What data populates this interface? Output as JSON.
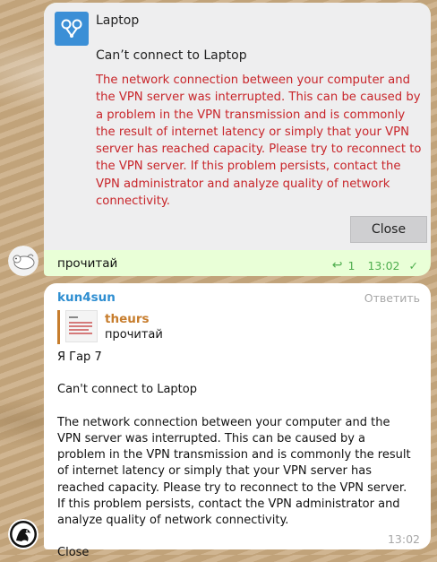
{
  "photo_message": {
    "dialog": {
      "title": "Laptop",
      "heading": "Can’t connect to Laptop",
      "body": "The network connection between your computer and the VPN server was interrupted.  This can be caused by a problem in the VPN transmission and is commonly the result of internet latency or simply that your VPN server has reached capacity.  Please try to reconnect to the VPN server.  If this problem persists, contact the VPN administrator and analyze quality of network connectivity.",
      "close_label": "Close"
    },
    "caption": "прочитай",
    "reply_count": "1",
    "time": "13:02",
    "read_mark": "✓"
  },
  "reply_message": {
    "sender": "kun4sun",
    "reply_action": "Ответить",
    "quote": {
      "author": "theurs",
      "text": "прочитай"
    },
    "lines": {
      "l1": "Я Гар 7",
      "l2": "Can't connect to Laptop",
      "l3": "The network connection between your computer and the VPN server was interrupted. This can be caused by a problem in the VPN transmission and is commonly the result of internet latency or simply that your VPN server has reached capacity. Please try to reconnect to the VPN server. If this problem persists, contact the VPN administrator and analyze quality of network connectivity.",
      "l4": "Close"
    },
    "time": "13:02"
  },
  "colors": {
    "outgoing_bubble": "#e9ffd7",
    "incoming_bubble": "#ffffff",
    "error_text": "#c8252a",
    "sender_name": "#2e8ed1",
    "quote_accent": "#c77d2d",
    "read_green": "#4fae4e"
  },
  "icons": {
    "app_logo": "vpn-logo-icon",
    "reply": "reply-arrow-icon",
    "read": "double-check-icon"
  }
}
